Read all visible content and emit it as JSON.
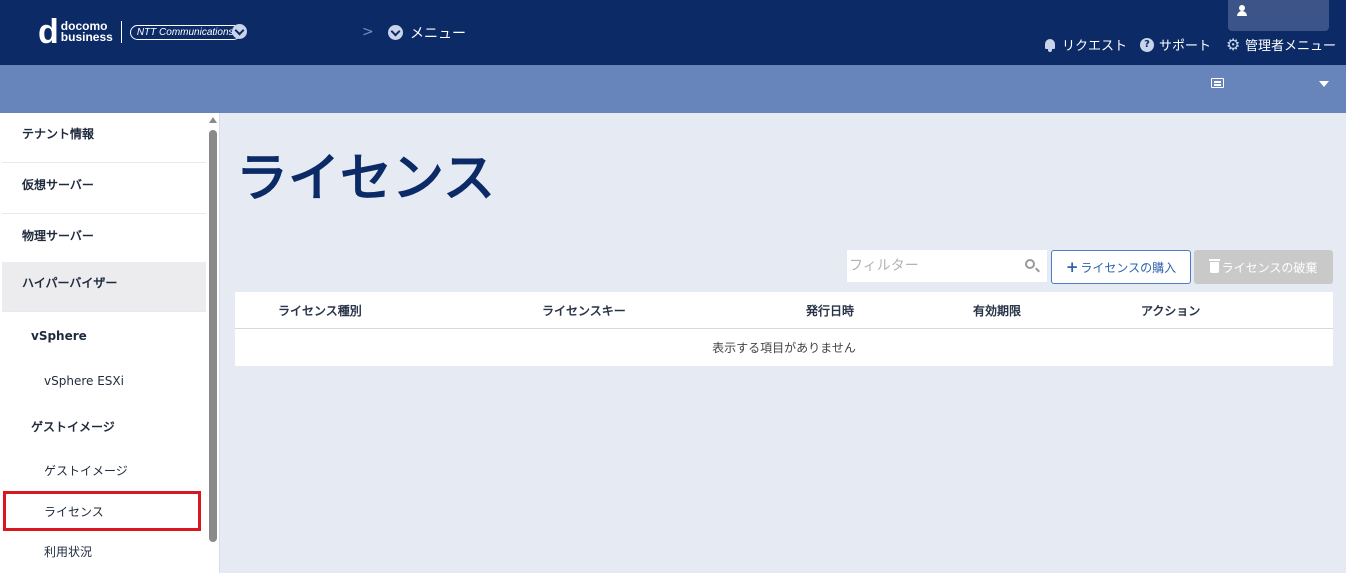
{
  "header": {
    "logo": {
      "brand_line1": "docomo",
      "brand_line2": "business",
      "partner": "NTT Communications"
    },
    "breadcrumb_separator": ">",
    "menu_label": "メニュー",
    "nav": [
      {
        "icon": "bell-icon",
        "label": "リクエスト"
      },
      {
        "icon": "help-circle-icon",
        "label": "サポート"
      },
      {
        "icon": "gear-icon",
        "label": "管理者メニュー"
      }
    ]
  },
  "sidebar": {
    "items": [
      {
        "level": 1,
        "label": "テナント情報"
      },
      {
        "level": 1,
        "label": "仮想サーバー"
      },
      {
        "level": 1,
        "label": "物理サーバー"
      },
      {
        "level": 1,
        "label": "ハイパーバイザー",
        "active": true
      },
      {
        "level": 2,
        "label": "vSphere"
      },
      {
        "level": 3,
        "label": "vSphere ESXi"
      },
      {
        "level": 2,
        "label": "ゲストイメージ"
      },
      {
        "level": 3,
        "label": "ゲストイメージ"
      },
      {
        "level": 3,
        "label": "ライセンス",
        "highlighted": true
      },
      {
        "level": 3,
        "label": "利用状況"
      }
    ]
  },
  "main": {
    "title": "ライセンス",
    "filter_placeholder": "フィルター",
    "buy_button": "ライセンスの購入",
    "delete_button": "ライセンスの破棄",
    "table": {
      "columns": [
        "ライセンス種別",
        "ライセンスキー",
        "発行日時",
        "有効期限",
        "アクション"
      ],
      "rows": [],
      "empty_message": "表示する項目がありません"
    }
  },
  "colors": {
    "header_bg": "#0b2a66",
    "subbar_bg": "#6784bb",
    "content_bg": "#e6eaf3",
    "highlight_border": "#d9171f",
    "primary_text": "#0b2a66"
  }
}
